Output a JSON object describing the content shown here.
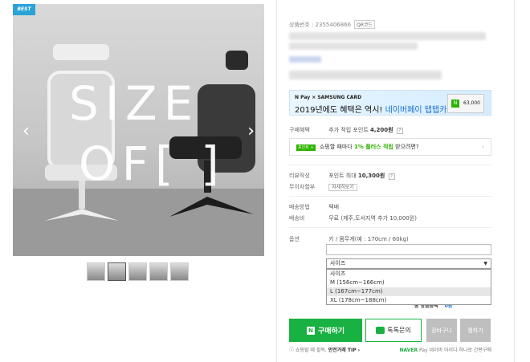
{
  "hero": {
    "badge": "BEST",
    "overlay_line1": "SIZE",
    "overlay_line2": "OF[ ]",
    "prev": "‹",
    "next": "›"
  },
  "thumbnails": [
    "",
    "",
    "",
    "",
    ""
  ],
  "product": {
    "number_label": "상품번호 : 2355406866",
    "qr_label": "QR코드"
  },
  "banner": {
    "pay_line": "N Pay × SAMSUNG CARD",
    "headline_prefix": "2019년에도 혜택은 역시!",
    "headline_highlight": "네이버페이 탭탭카드!",
    "card_amount": "63,000",
    "card_badge": "N"
  },
  "benefits": {
    "buy_label": "구매혜택",
    "buy_value": "추가 적립 포인트",
    "buy_points": "4,200원",
    "point_tag": "포인트 +",
    "point_text_prefix": "쇼핑할 때마다",
    "point_text_green": "1% 플러스 적립",
    "point_text_suffix": "받으려면?",
    "review_label": "리뷰작성",
    "review_value": "포인트 최대",
    "review_points": "10,300원",
    "interest_label": "무이자할부",
    "interest_btn": "자세히보기"
  },
  "delivery": {
    "method_label": "배송방법",
    "method_value": "택배",
    "fee_label": "배송비",
    "fee_value": "무료 (제주,도서지역 추가 10,000원)"
  },
  "options": {
    "label": "옵션",
    "hint": "키 / 몸무게(예 : 170cm / 60kg)",
    "select_value": "사이즈",
    "dropdown": [
      "사이즈",
      "M (156cm~166cm)",
      "L (167cm~177cm)",
      "XL (178cm~188cm)"
    ],
    "highlighted_index": 2
  },
  "qty_row": {
    "label": "총 상품금액",
    "price": "총 상품금액",
    "won": "0원"
  },
  "actions": {
    "buy": "구매하기",
    "buy_icon": "N",
    "talk": "톡톡문의",
    "cart": "장바구니",
    "wish": "찜하기"
  },
  "footer": {
    "safe_prefix": "쇼핑할 때 필독,",
    "safe_link": "안전거래 TIP ›",
    "npay_brand": "NAVER",
    "npay_text": "Pay 네이버 아이디 하나로 간편구매"
  },
  "colors": {
    "naver_green": "#19b142",
    "badge_blue": "#2aa3d8",
    "link_blue": "#1a6fd1"
  }
}
